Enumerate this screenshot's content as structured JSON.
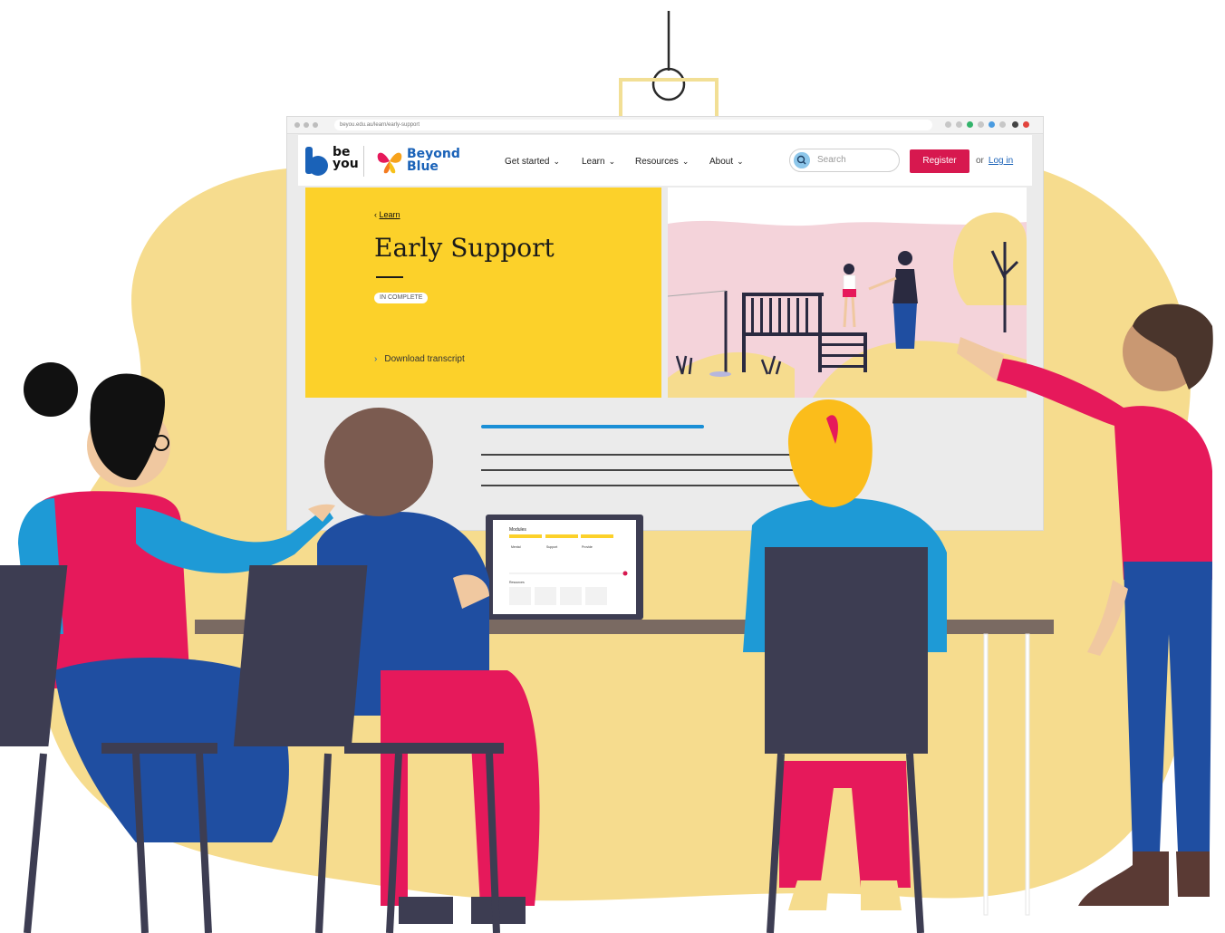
{
  "browser": {
    "url": "beyou.edu.au/learn/early-support"
  },
  "site": {
    "logo_beyou_line1": "be",
    "logo_beyou_line2": "you",
    "logo_partner_line1": "Beyond",
    "logo_partner_line2": "Blue",
    "nav": [
      {
        "label": "Get started"
      },
      {
        "label": "Learn"
      },
      {
        "label": "Resources"
      },
      {
        "label": "About"
      }
    ],
    "search_placeholder": "Search",
    "register_label": "Register",
    "or_text": "or",
    "login_label": "Log in"
  },
  "hero": {
    "back_label": "Learn",
    "title": "Early Support",
    "badge": "IN COMPLETE",
    "download_label": "Download transcript"
  },
  "laptop": {
    "heading": "Modules",
    "col1": "Mental",
    "col2": "Support",
    "col3": "Provide",
    "section2": "Resources"
  },
  "colors": {
    "blob": "#f6dc8e",
    "hero_yellow": "#fcd12a",
    "brand_blue": "#1a62b8",
    "register_red": "#d7184f",
    "shirt_red": "#e6195b",
    "chair": "#3d3d52",
    "desk": "#7a6a62"
  },
  "icons": [
    "back-chevron-icon",
    "search-icon",
    "chevron-down-icon",
    "download-chevron-icon",
    "butterfly-icon"
  ]
}
